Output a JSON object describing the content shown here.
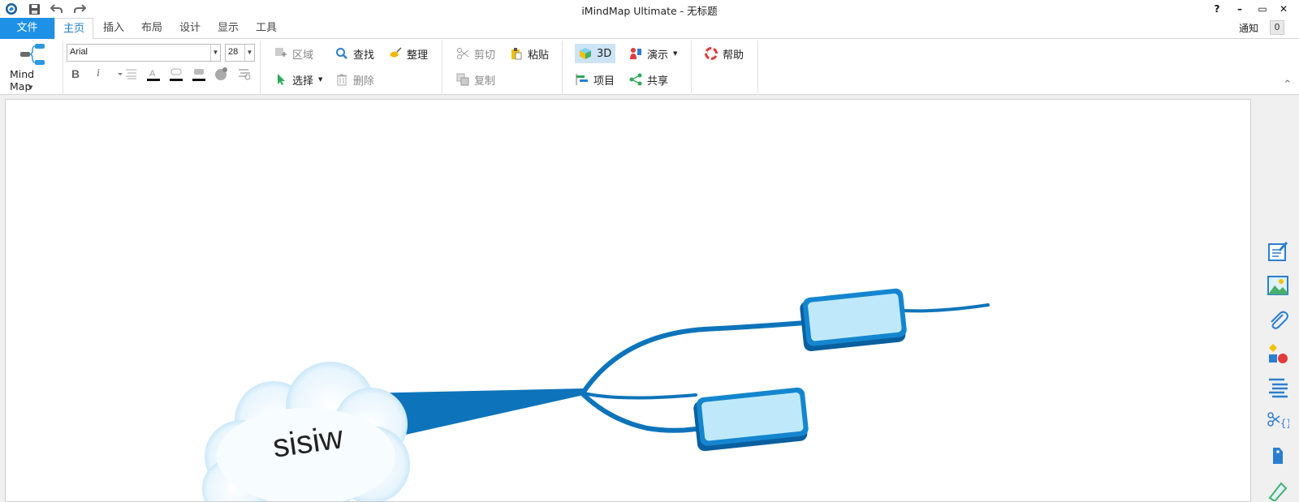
{
  "window": {
    "title": "iMindMap Ultimate - 无标题",
    "help_label": "?",
    "minimize_label": "–",
    "restore_label": "▭",
    "close_label": "✕"
  },
  "tabs": {
    "file": "文件",
    "home": "主页",
    "insert": "插入",
    "layout": "布局",
    "design": "设计",
    "view": "显示",
    "tools": "工具"
  },
  "notifications": {
    "label": "通知",
    "count": "0"
  },
  "ribbon": {
    "mind_map_label": "Mind Map",
    "font_name": "Arial",
    "font_size": "28",
    "bold": "B",
    "italic": "i",
    "region": "区域",
    "select": "选择",
    "find": "查找",
    "delete": "删除",
    "tidy": "整理",
    "cut": "剪切",
    "copy": "复制",
    "paste": "粘贴",
    "three_d": "3D",
    "project": "项目",
    "present": "演示",
    "share": "共享",
    "help": "帮助"
  },
  "map": {
    "central_text": "sisiw"
  },
  "colors": {
    "accent": "#1e90e6",
    "branch": "#0d74bb",
    "topic_fill": "#bfe9fb"
  }
}
